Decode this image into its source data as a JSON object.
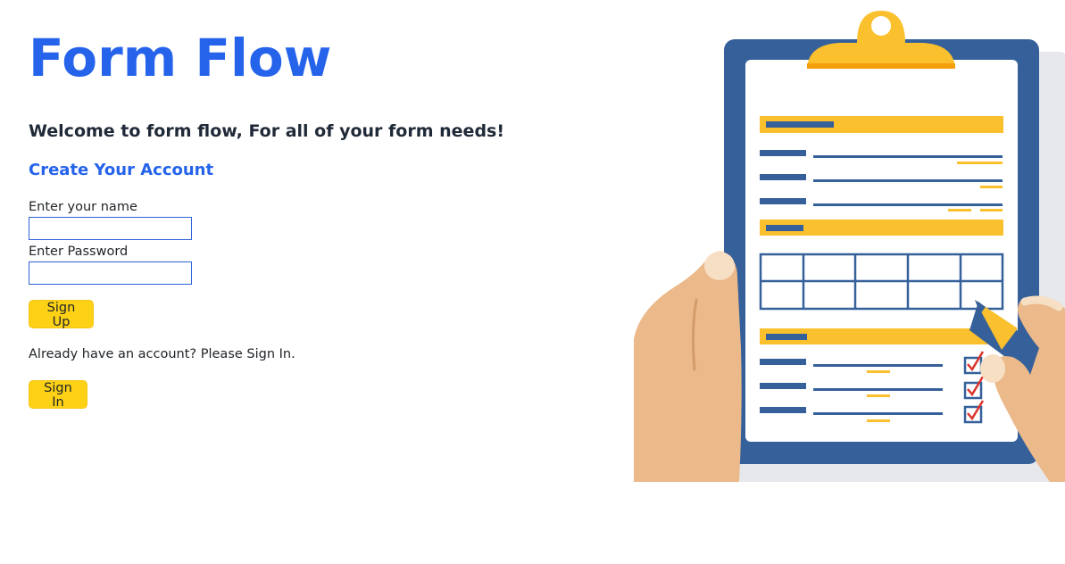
{
  "brand": {
    "title": "Form Flow"
  },
  "welcome": {
    "text": "Welcome to form flow, For all of your form needs!"
  },
  "signup": {
    "heading": "Create Your Account",
    "name_label": "Enter your name",
    "name_value": "",
    "password_label": "Enter Password",
    "password_value": "",
    "submit_label": "Sign Up"
  },
  "signin": {
    "prompt": "Already have an account? Please Sign In.",
    "button_label": "Sign In"
  },
  "illustration": {
    "icon": "clipboard-form-illustration",
    "colors": {
      "board": "#35609a",
      "paper": "#ffffff",
      "accent": "#fbc02d",
      "skin": "#ebb98a",
      "check": "#d9342b"
    }
  }
}
